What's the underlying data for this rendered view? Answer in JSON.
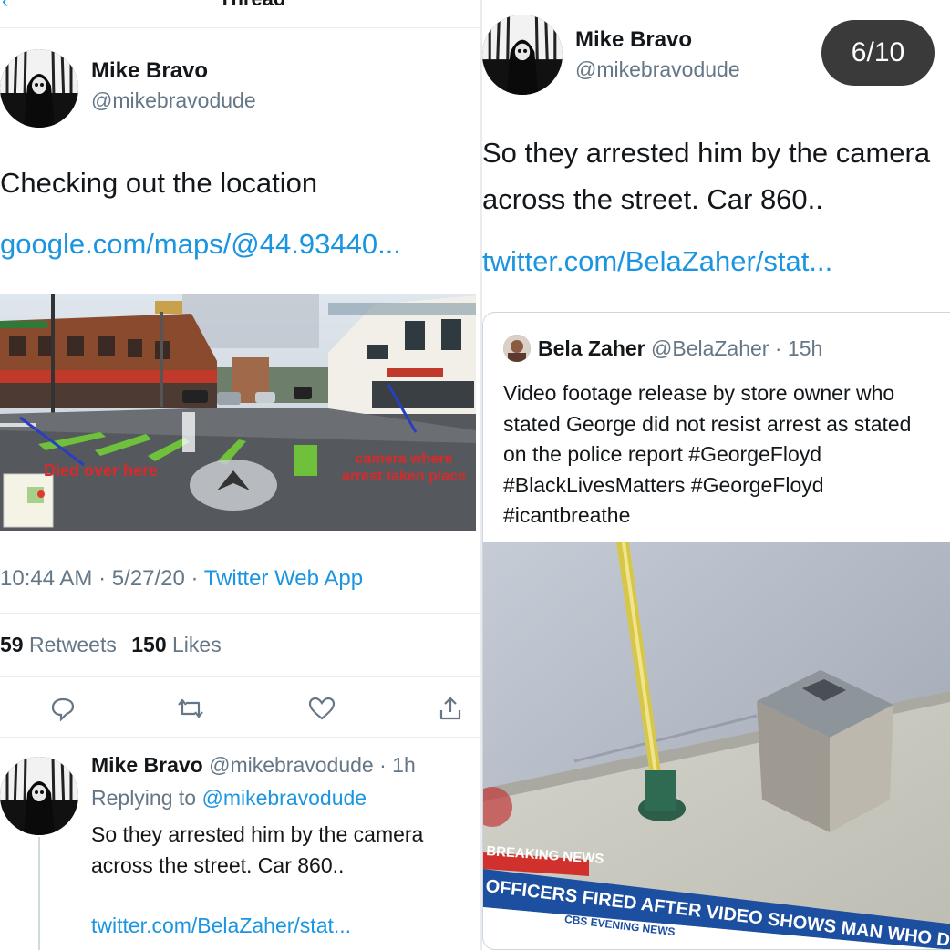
{
  "left_panel": {
    "header_title": "Thread",
    "tweet": {
      "author_name": "Mike Bravo",
      "author_handle": "@mikebravodude",
      "text": "Checking out the location",
      "link": "google.com/maps/@44.93440...",
      "image": {
        "streetview_labels": [
          "Died over here",
          "camera where arrest taken place"
        ]
      },
      "timestamp": "10:44 AM",
      "date": "5/27/20",
      "client": "Twitter Web App",
      "retweets_count": "59",
      "retweets_label": "Retweets",
      "likes_count": "150",
      "likes_label": "Likes",
      "actions": [
        "reply-icon",
        "retweet-icon",
        "heart-icon",
        "share-icon"
      ]
    },
    "reply": {
      "author_name": "Mike Bravo",
      "author_handle": "@mikebravodude",
      "time": "1h",
      "replying_prefix": "Replying to",
      "replying_to": "@mikebravodude",
      "text_line1": "So they arrested him by the camera",
      "text_line2": "across the street. Car 860..",
      "link": "twitter.com/BelaZaher/stat..."
    }
  },
  "right_panel": {
    "page_counter": "6/10",
    "author_name": "Mike Bravo",
    "author_handle": "@mikebravodude",
    "text_line1": "So they arrested him by the camera",
    "text_line2": "across the street. Car 860..",
    "link": "twitter.com/BelaZaher/stat...",
    "quoted": {
      "author_name": "Bela Zaher",
      "author_handle": "@BelaZaher",
      "time": "15h",
      "lines": [
        "Video footage release by store owner who",
        "stated George did not resist arrest as stated",
        "on the police report #GeorgeFloyd",
        "#BlackLivesMatters #GeorgeFloyd",
        "#icantbreathe"
      ],
      "image": {
        "banner_top": "BREAKING NEWS",
        "banner_main": "OFFICERS FIRED AFTER VIDEO SHOWS MAN WHO DI",
        "banner_sub": "CBS EVENING NEWS"
      }
    }
  },
  "colors": {
    "link": "#1b95e0",
    "muted": "#657786",
    "counter_bg": "#3a3a3a"
  }
}
